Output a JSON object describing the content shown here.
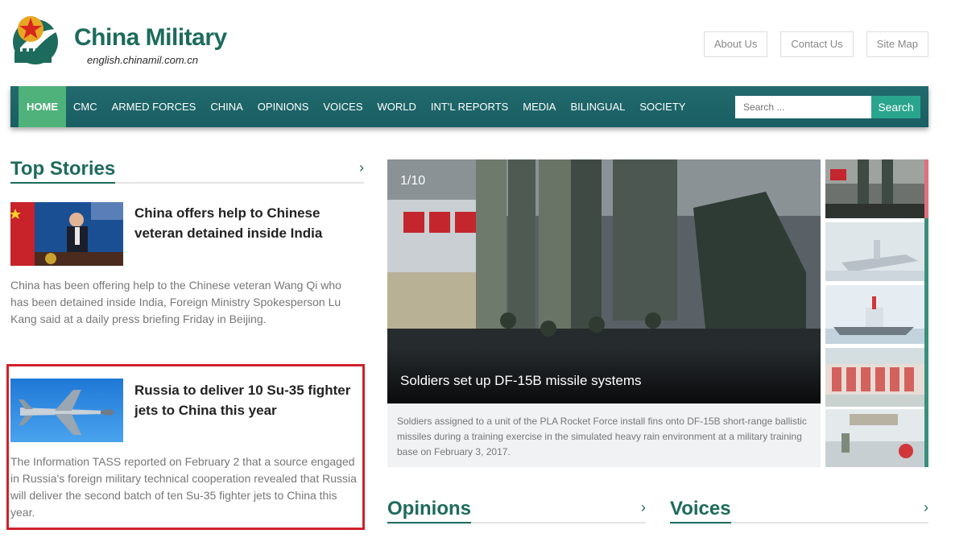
{
  "header": {
    "logo_title": "China Military",
    "logo_url": "english.chinamil.com.cn",
    "links": [
      "About Us",
      "Contact Us",
      "Site Map"
    ]
  },
  "nav": {
    "items": [
      "HOME",
      "CMC",
      "ARMED FORCES",
      "CHINA",
      "OPINIONS",
      "VOICES",
      "WORLD",
      "INT'L REPORTS",
      "MEDIA",
      "BILINGUAL",
      "SOCIETY"
    ],
    "active": "HOME",
    "search_placeholder": "Search ...",
    "search_button": "Search"
  },
  "top_stories": {
    "title": "Top Stories",
    "arrow": "›",
    "stories": [
      {
        "title": "China offers help to Chinese veteran detained inside India",
        "desc": "China has been offering help to the Chinese veteran Wang Qi who has been detained inside India, Foreign Ministry Spokesperson Lu Kang said at a daily press briefing Friday in Beijing."
      },
      {
        "title": "Russia to deliver 10 Su-35 fighter jets to China this year",
        "desc": "The Information TASS reported on February 2 that a source engaged in Russia's foreign military technical cooperation revealed that Russia will deliver the second batch of ten Su-35 fighter jets to China this year."
      }
    ]
  },
  "slider": {
    "counter": "1/10",
    "caption": "Soldiers set up DF-15B missile systems",
    "desc": "Soldiers assigned to a unit of the PLA Rocket Force install fins onto DF-15B short-range ballistic missiles during a training exercise in the simulated heavy rain environment at a military training base on February 3, 2017."
  },
  "opinions": {
    "title": "Opinions",
    "arrow": "›"
  },
  "voices": {
    "title": "Voices",
    "arrow": "›"
  },
  "colors": {
    "brand_green": "#1d6b5c",
    "nav_bg": "#1f6568",
    "nav_active": "#4fb27a",
    "search_btn": "#2aa58d",
    "highlight": "#d0212b"
  }
}
